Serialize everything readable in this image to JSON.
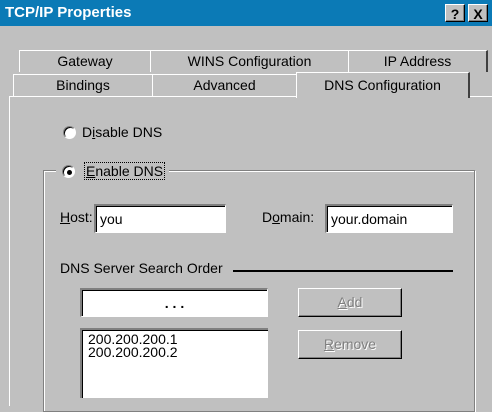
{
  "window": {
    "title": "TCP/IP Properties",
    "help_label": "?",
    "close_label": "X"
  },
  "tabs": {
    "row_back": [
      {
        "label": "Gateway"
      },
      {
        "label": "WINS Configuration"
      },
      {
        "label": "IP Address"
      }
    ],
    "row_front": [
      {
        "label": "Bindings"
      },
      {
        "label": "Advanced"
      },
      {
        "label": "DNS Configuration",
        "selected": true
      }
    ]
  },
  "dns": {
    "disable": {
      "pre": "D",
      "accel": "i",
      "post": "sable DNS",
      "checked": false
    },
    "enable": {
      "pre": "",
      "accel": "E",
      "post": "nable DNS",
      "checked": true
    },
    "host": {
      "accel": "H",
      "label_rest": "ost:",
      "value": "you"
    },
    "domain": {
      "pre": "D",
      "accel": "o",
      "label_rest": "main:",
      "value": "your.domain"
    },
    "server_order": {
      "label": "DNS Server Search Order",
      "ip_dots": ".          .          .",
      "add_accel": "A",
      "add_rest": "dd",
      "remove_accel": "R",
      "remove_rest": "emove",
      "servers": [
        "200.200.200.1",
        "200.200.200.2"
      ]
    }
  }
}
